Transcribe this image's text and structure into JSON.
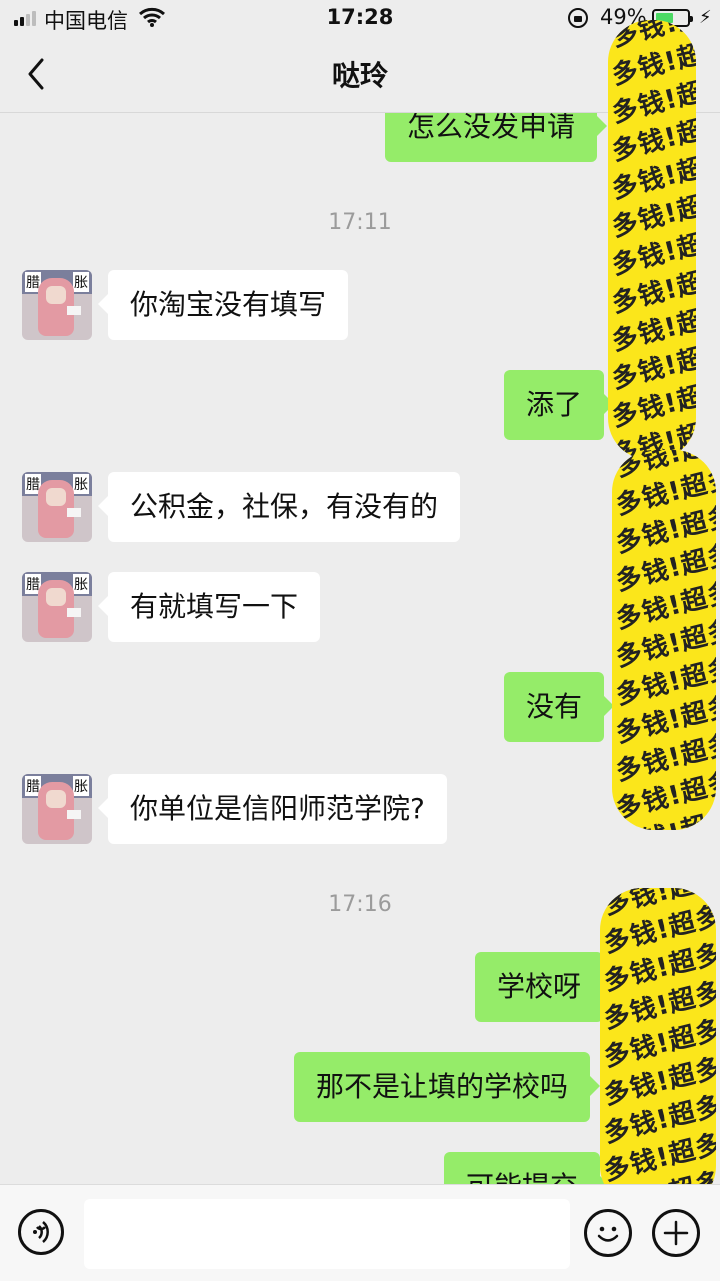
{
  "status_bar": {
    "carrier": "中国电信",
    "time": "17:28",
    "battery_percent": "49%",
    "battery_level": 0.49,
    "icons": [
      "signal-icon",
      "wifi-icon",
      "orientation-lock-icon",
      "battery-icon",
      "charging-icon"
    ]
  },
  "header": {
    "title": "哒玲",
    "back_icon": "chevron-left-icon"
  },
  "messages": [
    {
      "side": "out",
      "text": "怎么没发申请"
    },
    {
      "type": "timestamp",
      "text": "17:11"
    },
    {
      "side": "in",
      "text": "你淘宝没有填写"
    },
    {
      "side": "out",
      "text": "添了"
    },
    {
      "side": "in",
      "text": "公积金，社保，有没有的"
    },
    {
      "side": "in",
      "text": "有就填写一下"
    },
    {
      "side": "out",
      "text": "没有"
    },
    {
      "side": "in",
      "text": "你单位是信阳师范学院?"
    },
    {
      "type": "timestamp",
      "text": "17:16"
    },
    {
      "side": "out",
      "text": "学校呀"
    },
    {
      "side": "out",
      "text": "那不是让填的学校吗"
    },
    {
      "side": "out",
      "text": "可能提交"
    }
  ],
  "avatar": {
    "left_char": "腊",
    "right_char": "胀"
  },
  "sticker": {
    "text": "多钱!超多钱!超多钱!超",
    "color": "#fbe61b"
  },
  "input_bar": {
    "icons": [
      "voice-icon",
      "emoji-icon",
      "plus-icon"
    ],
    "placeholder": ""
  },
  "colors": {
    "outgoing_bubble": "#95ec69",
    "incoming_bubble": "#ffffff",
    "background": "#ededed"
  }
}
